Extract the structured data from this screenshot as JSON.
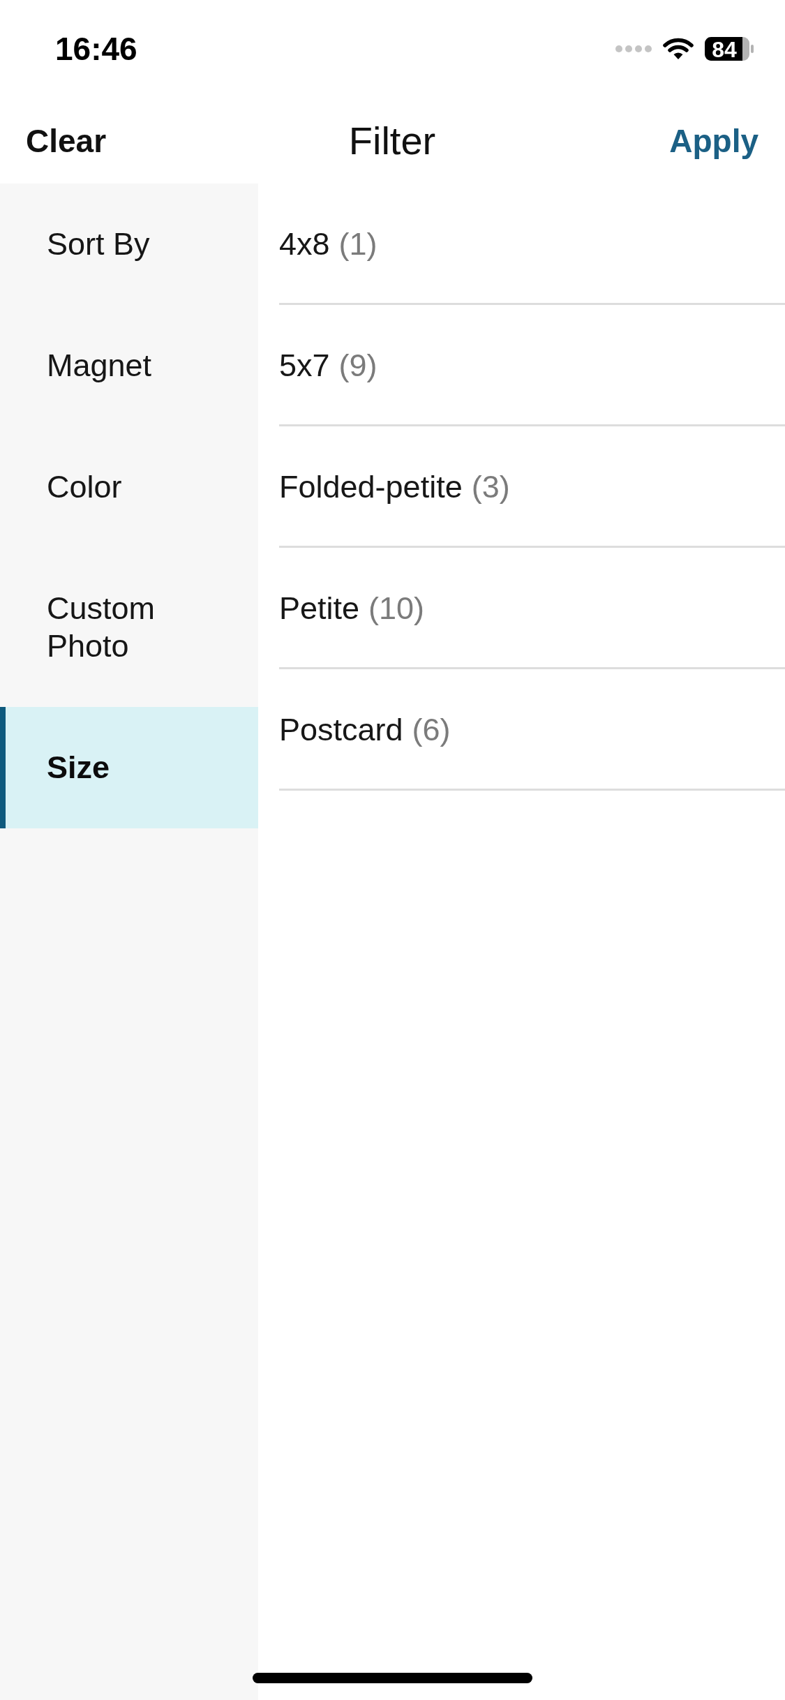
{
  "status_bar": {
    "time": "16:46",
    "battery": "84"
  },
  "header": {
    "left_action": "Clear",
    "title": "Filter",
    "right_action": "Apply"
  },
  "sidebar": {
    "items": [
      {
        "label": "Sort By",
        "selected": false
      },
      {
        "label": "Magnet",
        "selected": false
      },
      {
        "label": "Color",
        "selected": false
      },
      {
        "label": "Custom Photo",
        "selected": false
      },
      {
        "label": "Size",
        "selected": true
      }
    ]
  },
  "options": [
    {
      "label": "4x8",
      "count": "(1)"
    },
    {
      "label": "5x7",
      "count": "(9)"
    },
    {
      "label": "Folded-petite",
      "count": "(3)"
    },
    {
      "label": "Petite",
      "count": "(10)"
    },
    {
      "label": "Postcard",
      "count": "(6)"
    }
  ]
}
